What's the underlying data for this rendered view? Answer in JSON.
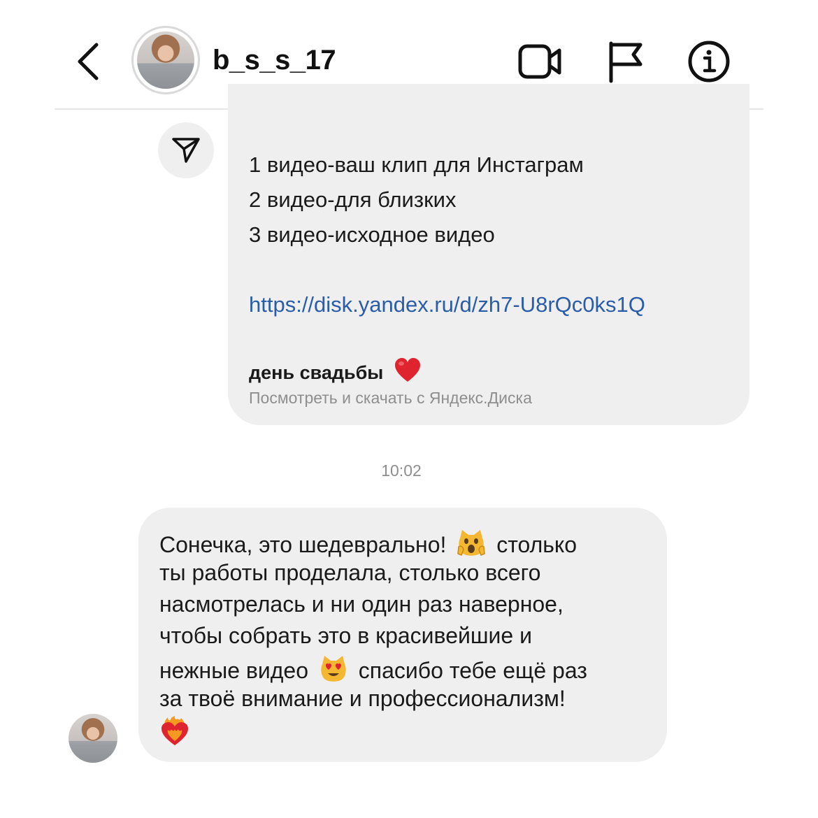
{
  "header": {
    "username": "b_s_s_17",
    "icons": [
      "back-icon",
      "video-call-icon",
      "flag-icon",
      "info-icon"
    ]
  },
  "outgoing_message": {
    "lines": [
      "1 видео-ваш клип для Инстаграм",
      "2 видео-для близких",
      "3 видео-исходное видео"
    ],
    "link": "https://disk.yandex.ru/d/zh7-U8rQc0ks1Q",
    "preview": {
      "title": "день свадьбы",
      "subtitle": "Посмотреть и скачать с Яндекс.Диска"
    }
  },
  "timestamp": "10:02",
  "incoming_message": {
    "lines": [
      [
        "Сонечка, это шедеврально!",
        "столько"
      ],
      [
        "ты работы проделала, столько всего"
      ],
      [
        "насмотрелась и ни один раз наверное,"
      ],
      [
        "чтобы собрать это в красивейшие и"
      ],
      [
        "нежные видео",
        "спасибо тебе ещё раз"
      ],
      [
        "за твоё внимание и профессионализм!"
      ]
    ]
  },
  "colors": {
    "bubble": "#efefef",
    "link": "#2a5da8",
    "muted": "#8e8e8e",
    "text": "#1a1a1a"
  }
}
